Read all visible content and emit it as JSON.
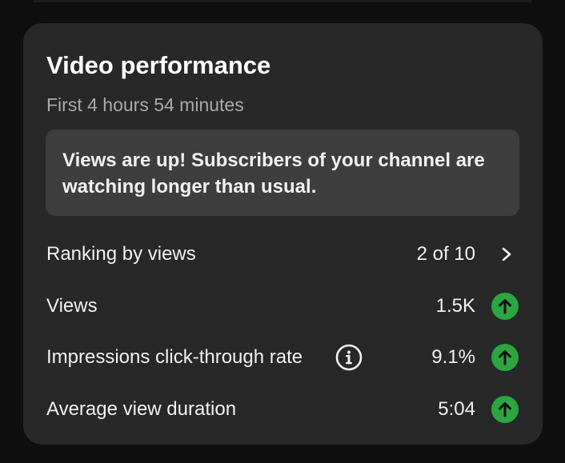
{
  "card": {
    "title": "Video performance",
    "subtitle": "First 4 hours 54 minutes",
    "insight": "Views are up! Subscribers of your channel are watching longer than usual."
  },
  "metrics": [
    {
      "label": "Ranking by views",
      "value": "2 of 10",
      "icon": "chevron-right-icon"
    },
    {
      "label": "Views",
      "value": "1.5K",
      "icon": "arrow-up-icon",
      "trend": "up"
    },
    {
      "label": "Impressions click-through rate",
      "value": "9.1%",
      "icon": "arrow-up-icon",
      "trend": "up",
      "info_icon": "info-icon"
    },
    {
      "label": "Average view duration",
      "value": "5:04",
      "icon": "arrow-up-icon",
      "trend": "up"
    }
  ],
  "colors": {
    "background": "#0f0f0f",
    "card": "#282828",
    "insight_box": "#3e3e3e",
    "trend_up": "#2ba640",
    "text_primary": "#f1f1f1",
    "text_secondary": "#aaaaaa"
  }
}
